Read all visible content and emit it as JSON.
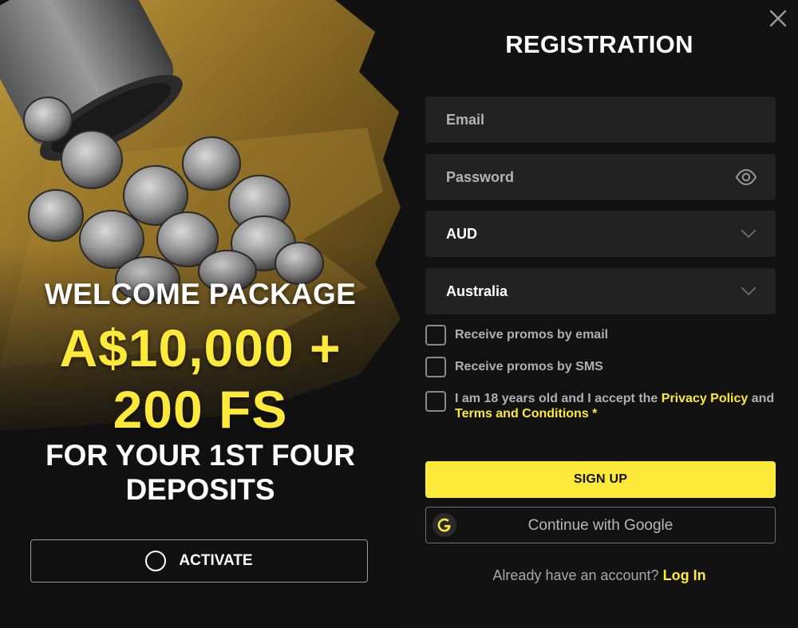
{
  "promo": {
    "headline": "WELCOME PACKAGE",
    "amount": "A$10,000 +",
    "spins": "200 FS",
    "deposits_line1": "FOR YOUR 1ST FOUR",
    "deposits_line2": "DEPOSITS",
    "activate_label": "ACTIVATE"
  },
  "form": {
    "title": "REGISTRATION",
    "email_placeholder": "Email",
    "password_placeholder": "Password",
    "currency_value": "AUD",
    "country_value": "Australia",
    "promo_email_label": "Receive promos by email",
    "promo_sms_label": "Receive promos by SMS",
    "terms_prefix": "I am 18 years old and I accept the",
    "privacy_link": "Privacy Policy",
    "terms_and": "and",
    "terms_link": "Terms and Conditions",
    "required_mark": "*",
    "signup_label": "SIGN UP",
    "google_label": "Continue with Google",
    "account_prompt": "Already have an account?",
    "login_link": "Log In"
  },
  "icons": {
    "close": "close-icon",
    "eye": "eye-icon",
    "chevron": "chevron-down-icon",
    "google": "google-icon",
    "radio": "radio-circle-icon"
  },
  "colors": {
    "accent": "#fde93a",
    "background": "#121212",
    "field": "#222222"
  }
}
